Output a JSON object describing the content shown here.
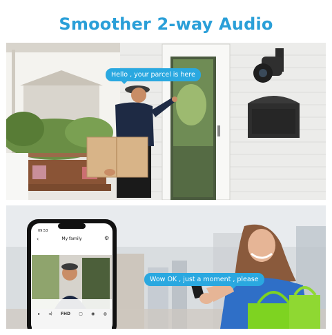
{
  "header": {
    "title": "Smoother 2-way Audio"
  },
  "scene_top": {
    "speech": "Hello , your parcel is here"
  },
  "scene_bottom": {
    "speech": "Wow OK , just a moment , please"
  },
  "phone": {
    "time": "09:53",
    "screen_title": "My family",
    "quality_label": "FHD"
  },
  "colors": {
    "accent": "#2a9fd8",
    "bubble": "#2aa8e0",
    "shopping_bag": "#7ed321",
    "dress": "#2f6fc7",
    "wall": "#ececea"
  }
}
